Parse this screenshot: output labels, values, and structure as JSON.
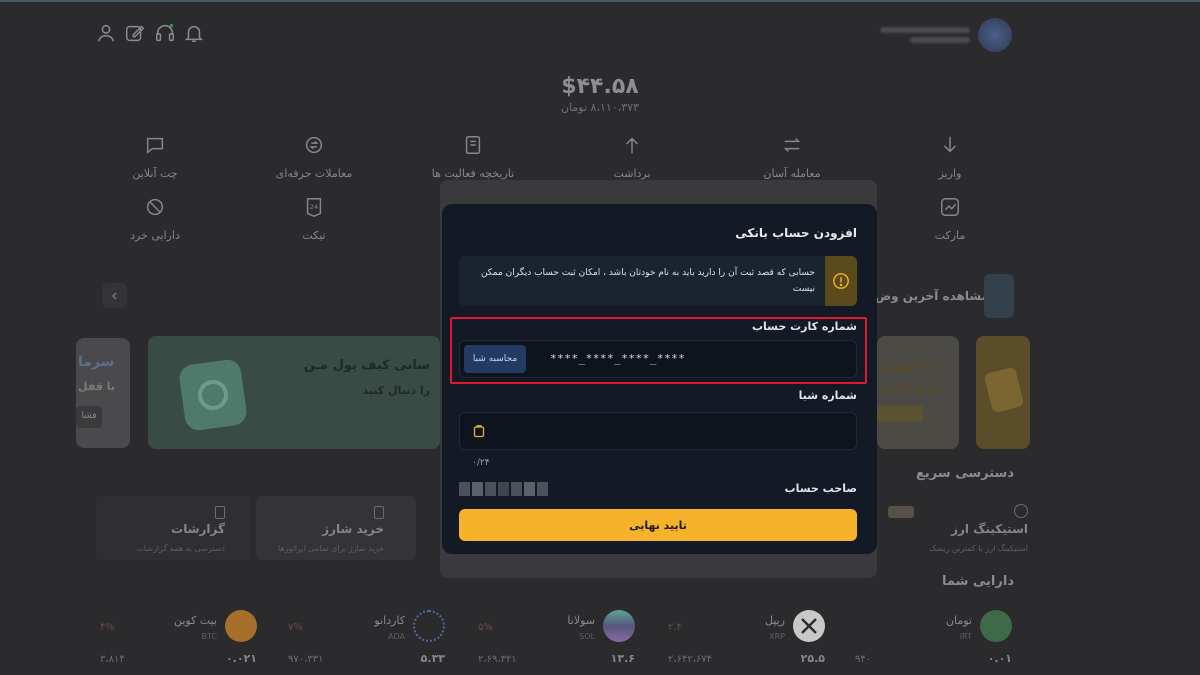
{
  "header": {
    "balance_usd": "$۴۴.۵۸",
    "balance_toman": "۸،۱۱۰،۳۷۳ تومان",
    "icons": [
      "user-icon",
      "edit-icon",
      "headset-icon",
      "bell-icon"
    ]
  },
  "menu": {
    "row1": [
      {
        "label": "واریز",
        "icon": "arrow-down-icon"
      },
      {
        "label": "معامله آسان",
        "icon": "swap-icon"
      },
      {
        "label": "برداشت",
        "icon": "arrow-up-icon"
      },
      {
        "label": "تاریخچه فعالیت ها",
        "icon": "history-icon"
      },
      {
        "label": "معاملات حرفه‌ای",
        "icon": "exchange-icon"
      },
      {
        "label": "چت آنلاین",
        "icon": "chat-icon"
      }
    ],
    "row2": [
      {
        "label": "مارکت",
        "icon": "chart-icon"
      },
      {
        "label": "تیکت",
        "icon": "ticket-icon"
      },
      {
        "label": "دارایی خرد",
        "icon": "dust-icon"
      }
    ]
  },
  "recent": {
    "label": "مشاهده آخرین وض"
  },
  "banners": {
    "b1_line1": "سانی کیف پول مـن",
    "b1_line2": "را دنبال کنید",
    "b2_line1": "۲۰۰ سوت",
    "b2_line2": "فقط کافیه ا",
    "b3_line1": "سرما",
    "b3_line2": "با قفل",
    "b3_line3": "فشا"
  },
  "quick_access": {
    "title": "دسترسی سریع",
    "items": [
      {
        "title": "استیکینگ ارز",
        "sub": "استیکینگ ارز با کمترین ریسک"
      },
      {
        "title": "خرید شارژ",
        "sub": "خرید شارژ برای تمامی اپراتورها"
      },
      {
        "title": "گزارشات",
        "sub": "دسترسی به همه گزارشات"
      }
    ]
  },
  "assets": {
    "title": "دارایی شما",
    "items": [
      {
        "name": "تومان",
        "sym": "IRT",
        "balance": "۰.۰۱",
        "value": "۹۴۰"
      },
      {
        "name": "ریپل",
        "sym": "XRP",
        "balance": "۲۵.۵",
        "value": "۲،۶۴۲،۶۷۴",
        "change": "۲.۴"
      },
      {
        "name": "سولانا",
        "sym": "SOL",
        "balance": "۱۳.۶",
        "value": "۲،۶۹،۳۲۱",
        "change": "۵%"
      },
      {
        "name": "کاردانو",
        "sym": "ADA",
        "balance": "۵.۳۳",
        "value": "۹۷۰،۳۳۱",
        "change": "۷%"
      },
      {
        "name": "بیت کوین",
        "sym": "BTC",
        "balance": "۰.۰۲۱",
        "value": "۳،۸۱۴",
        "change": "۴%"
      }
    ]
  },
  "modal": {
    "title": "افزودن حساب بانکی",
    "warning": "حسابی که قصد ثبت آن را دارید باید به نام خودتان باشد ، امکان ثبت حساب دیگران ممکن نیست",
    "card_label": "شماره کارت حساب",
    "card_value": "****_****_****_****",
    "calc_button": "محاسبه شبا",
    "sheba_label": "شماره شبا",
    "sheba_counter": "۰/۲۴",
    "owner_label": "صاحب حساب",
    "submit": "تایید نهایی"
  },
  "colors": {
    "accent": "#f7b22c",
    "modal_bg": "#131a26",
    "highlight": "#e0172d",
    "warning_bg": "#5b4a1c"
  }
}
